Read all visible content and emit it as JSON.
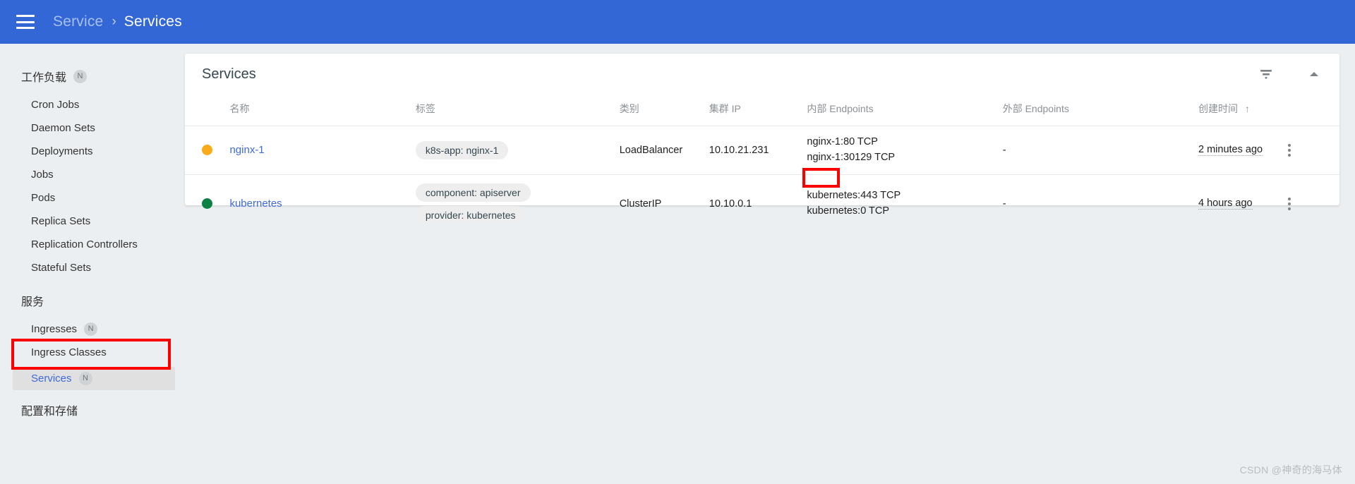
{
  "header": {
    "menu_icon": "hamburger-icon",
    "breadcrumb_parent": "Service",
    "breadcrumb_separator": "›",
    "breadcrumb_current": "Services",
    "background_color": "#3367d6"
  },
  "sidebar": {
    "sections": [
      {
        "label": "工作负载",
        "badge": "N",
        "items": [
          {
            "label": "Cron Jobs",
            "badge": "",
            "active": false
          },
          {
            "label": "Daemon Sets",
            "badge": "",
            "active": false
          },
          {
            "label": "Deployments",
            "badge": "",
            "active": false
          },
          {
            "label": "Jobs",
            "badge": "",
            "active": false
          },
          {
            "label": "Pods",
            "badge": "",
            "active": false
          },
          {
            "label": "Replica Sets",
            "badge": "",
            "active": false
          },
          {
            "label": "Replication Controllers",
            "badge": "",
            "active": false
          },
          {
            "label": "Stateful Sets",
            "badge": "",
            "active": false
          }
        ]
      },
      {
        "label": "服务",
        "badge": "",
        "items": [
          {
            "label": "Ingresses",
            "badge": "N",
            "active": false
          },
          {
            "label": "Ingress Classes",
            "badge": "",
            "active": false
          },
          {
            "label": "Services",
            "badge": "N",
            "active": true
          }
        ]
      },
      {
        "label": "配置和存储",
        "badge": "",
        "items": []
      }
    ],
    "active_item_color": "#3f6ad8"
  },
  "card": {
    "title": "Services",
    "filter_icon": "filter-icon",
    "collapse_icon": "chevron-up-icon"
  },
  "table": {
    "columns": [
      "名称",
      "标签",
      "类别",
      "集群 IP",
      "内部 Endpoints",
      "外部 Endpoints",
      "创建时间"
    ],
    "sort_column": "创建时间",
    "sort_indicator": "↑",
    "rows": [
      {
        "status_color": "#f9ab1c",
        "status_name": "pending",
        "name": "nginx-1",
        "labels": [
          "k8s-app: nginx-1"
        ],
        "type": "LoadBalancer",
        "cluster_ip": "10.10.21.231",
        "internal_endpoints": [
          "nginx-1:80 TCP",
          "nginx-1:30129 TCP"
        ],
        "external_endpoints": "-",
        "created": "2 minutes ago",
        "menu_icon": "kebab-menu-icon"
      },
      {
        "status_color": "#0b8043",
        "status_name": "running",
        "name": "kubernetes",
        "labels": [
          "component: apiserver",
          "provider: kubernetes"
        ],
        "type": "ClusterIP",
        "cluster_ip": "10.10.0.1",
        "internal_endpoints": [
          "kubernetes:443 TCP",
          "kubernetes:0 TCP"
        ],
        "external_endpoints": "-",
        "created": "4 hours ago",
        "menu_icon": "kebab-menu-icon"
      }
    ]
  },
  "annotations": {
    "color": "#fb0000",
    "highlighted_port": "30129",
    "highlighted_nav_item": "Services"
  },
  "watermark": "CSDN @神奇的海马体"
}
